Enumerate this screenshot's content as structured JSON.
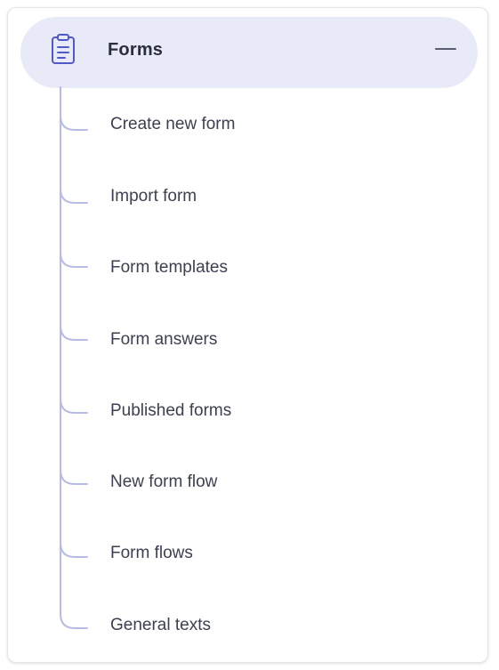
{
  "menu": {
    "title": "Forms",
    "icon": "clipboard-icon",
    "collapse_icon": "minus-icon",
    "accent_bg": "#e9eaf8",
    "tree_line_color": "#b6bce3",
    "items": [
      {
        "label": "Create new form"
      },
      {
        "label": "Import form"
      },
      {
        "label": "Form templates"
      },
      {
        "label": "Form answers"
      },
      {
        "label": "Published forms"
      },
      {
        "label": "New form flow"
      },
      {
        "label": "Form flows"
      },
      {
        "label": "General texts"
      }
    ]
  }
}
